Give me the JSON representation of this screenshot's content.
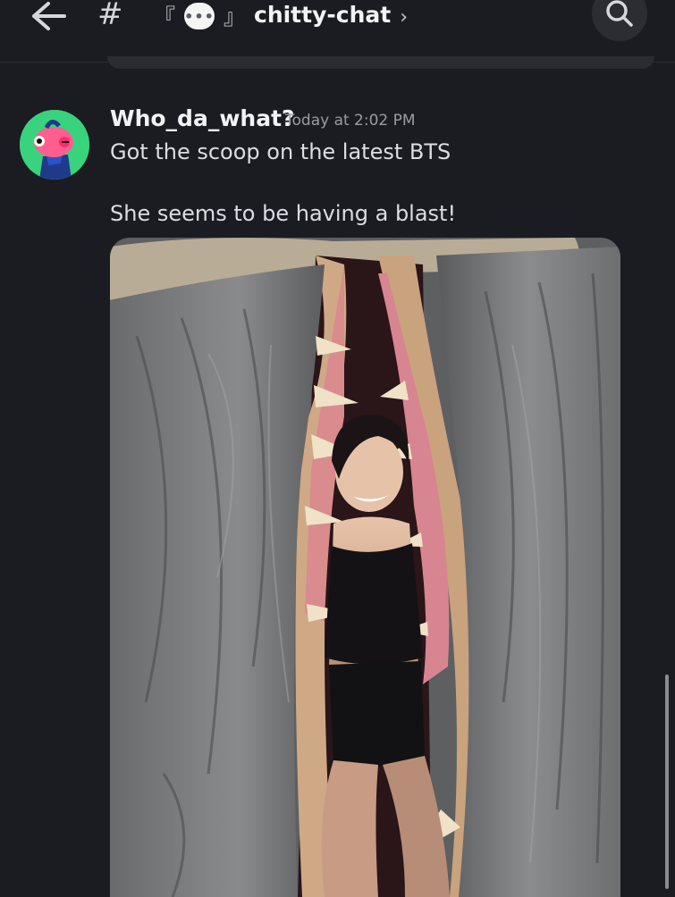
{
  "header": {
    "hash_symbol": "#",
    "channel_prefix": "『",
    "channel_suffix": "』",
    "bubble_icon_text": "•••",
    "channel_name": "chitty-chat",
    "chevron": "›"
  },
  "message": {
    "username": "Who_da_what?",
    "timestamp": "Today at 2:02 PM",
    "lines": [
      "Got the scoop on the latest BTS",
      "She seems to be having a blast!"
    ]
  },
  "colors": {
    "background": "#1b1c21",
    "avatar_bg": "#38d37c",
    "username": "#f2f3f5",
    "timestamp": "#9a9ca3"
  },
  "icons": {
    "back": "arrow-left-icon",
    "search": "search-icon"
  }
}
